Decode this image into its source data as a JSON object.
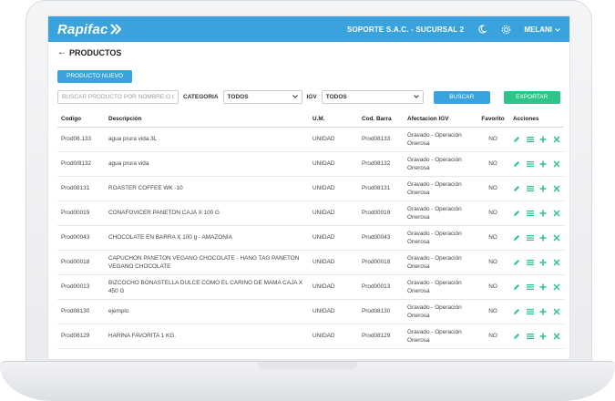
{
  "app": {
    "logo_text": "Rapifac",
    "company": "SOPORTE S.A.C. - SUCURSAL 2",
    "user": "MELANI"
  },
  "page": {
    "title": "PRODUCTOS",
    "new_button": "PRODUCTO NUEVO"
  },
  "filters": {
    "search_placeholder": "BUSCAR PRODUCTO POR NOMBRE O CODI",
    "category_label": "CATEGORIA",
    "category_value": "TODOS",
    "igv_label": "IGV",
    "igv_value": "TODOS",
    "search_button": "BUSCAR",
    "export_button": "EXPORTAR"
  },
  "table": {
    "headers": [
      "Codigo",
      "Descripción",
      "U.M.",
      "Cod. Barra",
      "Afectacion IGV",
      "Favorito",
      "Acciones"
    ],
    "rows": [
      [
        "Prod08.133",
        "agua prura vida 3L",
        "UNIDAD",
        "Prod08133",
        "Gravado - Operación Onerosa",
        "NO"
      ],
      [
        "Prod0/8132",
        "agua prura vida",
        "UNIDAD",
        "Prod08132",
        "Gravado - Operación Onerosa",
        "NO"
      ],
      [
        "Prod08131",
        "ROASTER COFFEE WK -10",
        "UNIDAD",
        "Prod08131",
        "Gravado - Operación Onerosa",
        "NO"
      ],
      [
        "Prod00019",
        "CONAFOVICER PANETON CAJA X 100 G",
        "UNIDAD",
        "Prod00019",
        "Gravado - Operación Onerosa",
        "NO"
      ],
      [
        "Prod00043",
        "CHOCOLATE EN BARRA X 100 g - AMAZONIA",
        "UNIDAD",
        "Prod00043",
        "Gravado - Operación Onerosa",
        "NO"
      ],
      [
        "Prod00018",
        "CAPUCHON PANETON VEGANO CHOCOLATE - HANG TAG PANETON VEGANO CHOCOLATE",
        "UNIDAD",
        "Prod00018",
        "Gravado - Operación Onerosa",
        "NO"
      ],
      [
        "Prod00013",
        "BIZCOCHO BONASTELLA DULCE COMO EL CARINO DE MAMA CAJA X 450 G",
        "UNIDAD",
        "Prod00013",
        "Gravado - Operación Onerosa",
        "NO"
      ],
      [
        "Prod08130",
        "ejemplo",
        "UNIDAD",
        "Prod08130",
        "Gravado - Operación Onerosa",
        "NO"
      ],
      [
        "Prod08129",
        "HARINA FAVORITA 1 KG.",
        "UNIDAD",
        "Prod08129",
        "Gravado - Operación Onerosa",
        "NO"
      ]
    ]
  },
  "icons": {
    "moon": "moon-icon",
    "gear": "gear-icon",
    "chevron": "chevron-down-icon",
    "back": "arrow-left-icon",
    "edit": "pencil-icon",
    "list": "list-icon",
    "add": "plus-icon",
    "delete": "close-icon"
  },
  "colors": {
    "brand": "#3aa3dd",
    "export": "#2ec48a",
    "action": "#2ec48a"
  }
}
